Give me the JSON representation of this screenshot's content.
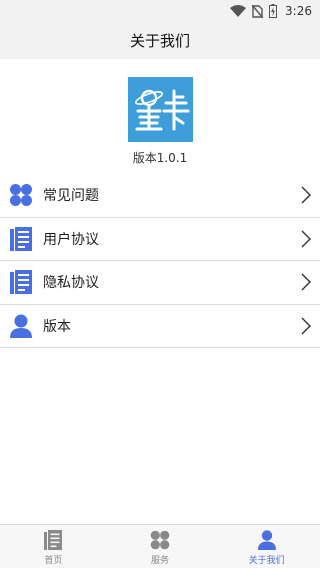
{
  "status_bar": {
    "time": "3:26",
    "icons": [
      "wifi-icon",
      "no-sim-icon",
      "battery-charging-icon"
    ]
  },
  "header": {
    "title": "关于我们"
  },
  "about": {
    "logo_text": "星卡",
    "version_text": "版本1.0.1"
  },
  "menu": {
    "items": [
      {
        "label": "常见问题",
        "icon": "grid-clover-icon"
      },
      {
        "label": "用户协议",
        "icon": "document-icon"
      },
      {
        "label": "隐私协议",
        "icon": "document-icon"
      },
      {
        "label": "版本",
        "icon": "user-icon"
      }
    ]
  },
  "tabbar": {
    "tabs": [
      {
        "label": "首页",
        "icon": "document-icon",
        "active": false
      },
      {
        "label": "服务",
        "icon": "grid-clover-icon",
        "active": false
      },
      {
        "label": "关于我们",
        "icon": "user-icon",
        "active": true
      }
    ]
  },
  "colors": {
    "accent": "#4a6fe3",
    "logo_bg": "#3d9ed9",
    "header_bg": "#f2f2f2",
    "inactive_icon": "#8a8a8a"
  }
}
